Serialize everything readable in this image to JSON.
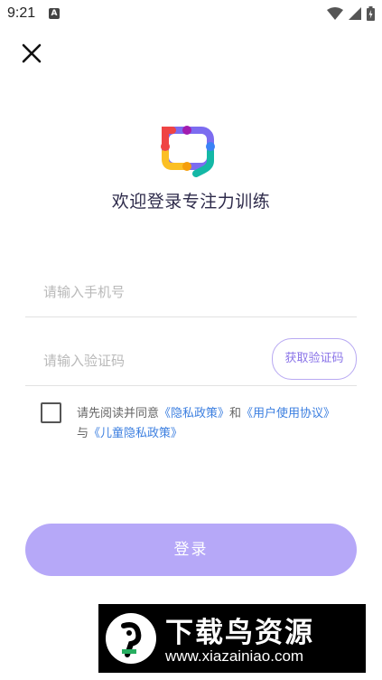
{
  "status_bar": {
    "time": "9:21",
    "notification_icon": "A",
    "icons": [
      "wifi-icon",
      "signal-icon",
      "battery-icon"
    ]
  },
  "header": {
    "close_icon": "close-icon"
  },
  "brand": {
    "welcome": "欢迎登录专注力训练",
    "logo_colors": [
      "#ef4444",
      "#f59e0b",
      "#8b5cf6",
      "#3b82f6",
      "#10b981"
    ]
  },
  "form": {
    "phone_placeholder": "请输入手机号",
    "code_placeholder": "请输入验证码",
    "get_code_label": "获取验证码"
  },
  "agreement": {
    "prefix": "请先阅读并同意",
    "privacy": "《隐私政策》",
    "and": "和",
    "user_agreement": "《用户使用协议》",
    "with": "与",
    "child_privacy": "《儿童隐私政策》"
  },
  "login_label": "登录",
  "watermark": {
    "title": "下载鸟资源",
    "url": "www.xiazainiao.com"
  },
  "colors": {
    "accent": "#b6a8f8",
    "link": "#3c7fe0",
    "code_button": "#8a74e8"
  }
}
